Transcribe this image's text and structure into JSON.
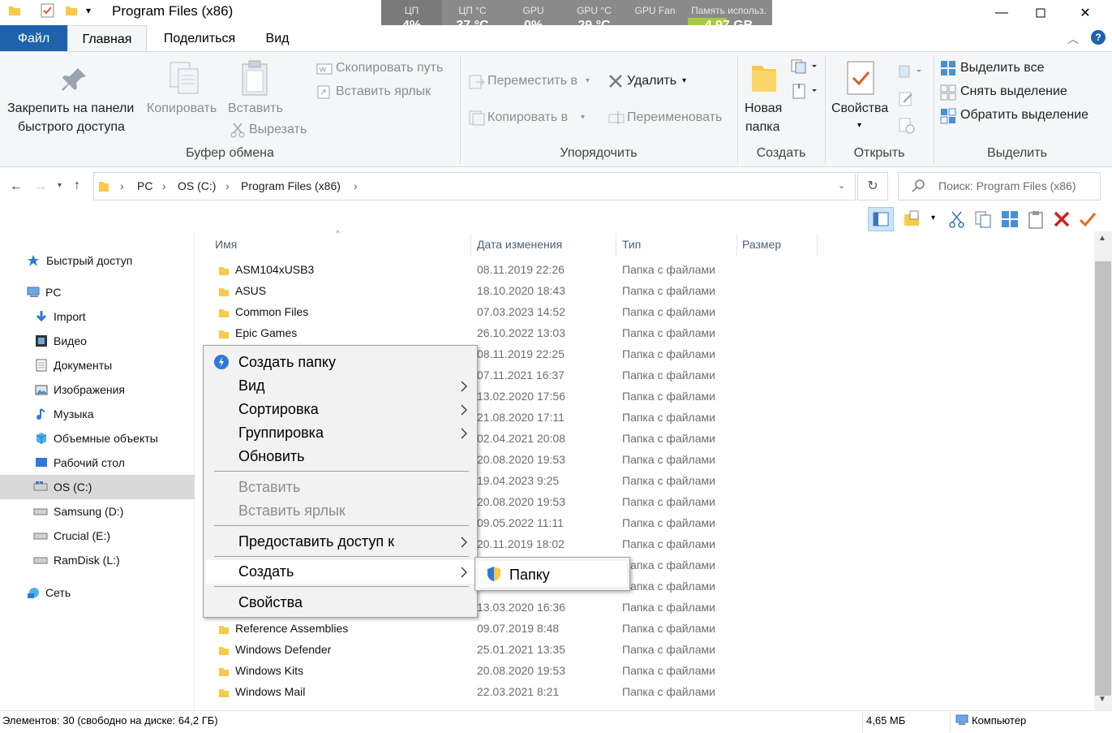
{
  "window": {
    "title": "Program Files (x86)"
  },
  "monitor": {
    "cells": [
      {
        "label": "ЦП",
        "value": "4%"
      },
      {
        "label": "ЦП °С",
        "value": "37 °C"
      },
      {
        "label": "GPU",
        "value": "0%"
      },
      {
        "label": "GPU °С",
        "value": "29 °C"
      },
      {
        "label": "GPU Fan",
        "value": "-----"
      },
      {
        "label": "Память использ.",
        "value": "4.97 GB"
      }
    ]
  },
  "tabs": {
    "file": "Файл",
    "home": "Главная",
    "share": "Поделиться",
    "view": "Вид"
  },
  "ribbon": {
    "clipboard": {
      "pin": [
        "Закрепить на панели",
        "быстрого доступа"
      ],
      "copy": "Копировать",
      "paste": "Вставить",
      "copy_path": "Скопировать путь",
      "paste_shortcut": "Вставить ярлык",
      "cut": "Вырезать",
      "group": "Буфер обмена"
    },
    "organize": {
      "move_to": "Переместить в",
      "copy_to": "Копировать в",
      "delete": "Удалить",
      "rename": "Переименовать",
      "group": "Упорядочить"
    },
    "new": {
      "new_folder": [
        "Новая",
        "папка"
      ],
      "group": "Создать"
    },
    "open": {
      "properties": "Свойства",
      "group": "Открыть"
    },
    "select": {
      "select_all": "Выделить все",
      "select_none": "Снять выделение",
      "invert": "Обратить выделение",
      "group": "Выделить"
    }
  },
  "address": {
    "crumbs": [
      "PC",
      "OS (C:)",
      "Program Files (x86)"
    ],
    "search_placeholder": "Поиск: Program Files (x86)"
  },
  "nav": {
    "quick_access": "Быстрый доступ",
    "pc": "PC",
    "items": [
      "Import",
      "Видео",
      "Документы",
      "Изображения",
      "Музыка",
      "Объемные объекты",
      "Рабочий стол",
      "OS (C:)",
      "Samsung (D:)",
      "Crucial (E:)",
      "RamDisk (L:)"
    ],
    "network": "Сеть"
  },
  "columns": {
    "name": "Имя",
    "date": "Дата изменения",
    "type": "Тип",
    "size": "Размер"
  },
  "files": [
    {
      "name": "ASM104xUSB3",
      "date": "08.11.2019 22:26",
      "type": "Папка с файлами"
    },
    {
      "name": "ASUS",
      "date": "18.10.2020 18:43",
      "type": "Папка с файлами"
    },
    {
      "name": "Common Files",
      "date": "07.03.2023 14:52",
      "type": "Папка с файлами"
    },
    {
      "name": "Epic Games",
      "date": "26.10.2022 13:03",
      "type": "Папка с файлами"
    },
    {
      "name": "",
      "date": "08.11.2019 22:25",
      "type": "Папка с файлами"
    },
    {
      "name": "",
      "date": "07.11.2021 16:37",
      "type": "Папка с файлами"
    },
    {
      "name": "",
      "date": "13.02.2020 17:56",
      "type": "Папка с файлами"
    },
    {
      "name": "",
      "date": "21.08.2020 17:11",
      "type": "Папка с файлами"
    },
    {
      "name": "",
      "date": "02.04.2021 20:08",
      "type": "Папка с файлами"
    },
    {
      "name": "",
      "date": "20.08.2020 19:53",
      "type": "Папка с файлами"
    },
    {
      "name": "",
      "date": "19.04.2023 9:25",
      "type": "Папка с файлами"
    },
    {
      "name": "",
      "date": "20.08.2020 19:53",
      "type": "Папка с файлами"
    },
    {
      "name": "",
      "date": "09.05.2022 11:11",
      "type": "Папка с файлами"
    },
    {
      "name": "",
      "date": "20.11.2019 18:02",
      "type": "Папка с файлами"
    },
    {
      "name": "",
      "date": "",
      "type": "Папка с файлами"
    },
    {
      "name": "",
      "date": "",
      "type": "Папка с файлами"
    },
    {
      "name": "",
      "date": "13.03.2020 16:36",
      "type": "Папка с файлами"
    },
    {
      "name": "Reference Assemblies",
      "date": "09.07.2019 8:48",
      "type": "Папка с файлами"
    },
    {
      "name": "Windows Defender",
      "date": "25.01.2021 13:35",
      "type": "Папка с файлами"
    },
    {
      "name": "Windows Kits",
      "date": "20.08.2020 19:53",
      "type": "Папка с файлами"
    },
    {
      "name": "Windows Mail",
      "date": "22.03.2021 8:21",
      "type": "Папка с файлами"
    }
  ],
  "context_menu": {
    "new_folder": "Создать папку",
    "view": "Вид",
    "sort": "Сортировка",
    "group": "Группировка",
    "refresh": "Обновить",
    "paste": "Вставить",
    "paste_shortcut": "Вставить ярлык",
    "share": "Предоставить доступ к",
    "create": "Создать",
    "properties": "Свойства"
  },
  "submenu": {
    "folder": "Папку"
  },
  "status": {
    "left": "Элементов: 30 (свободно на диске: 64,2 ГБ)",
    "size": "4,65 МБ",
    "computer": "Компьютер"
  },
  "colors": {
    "accent": "#1f63ad",
    "folder": "#f8c94a",
    "selection": "#d9d9d9"
  }
}
